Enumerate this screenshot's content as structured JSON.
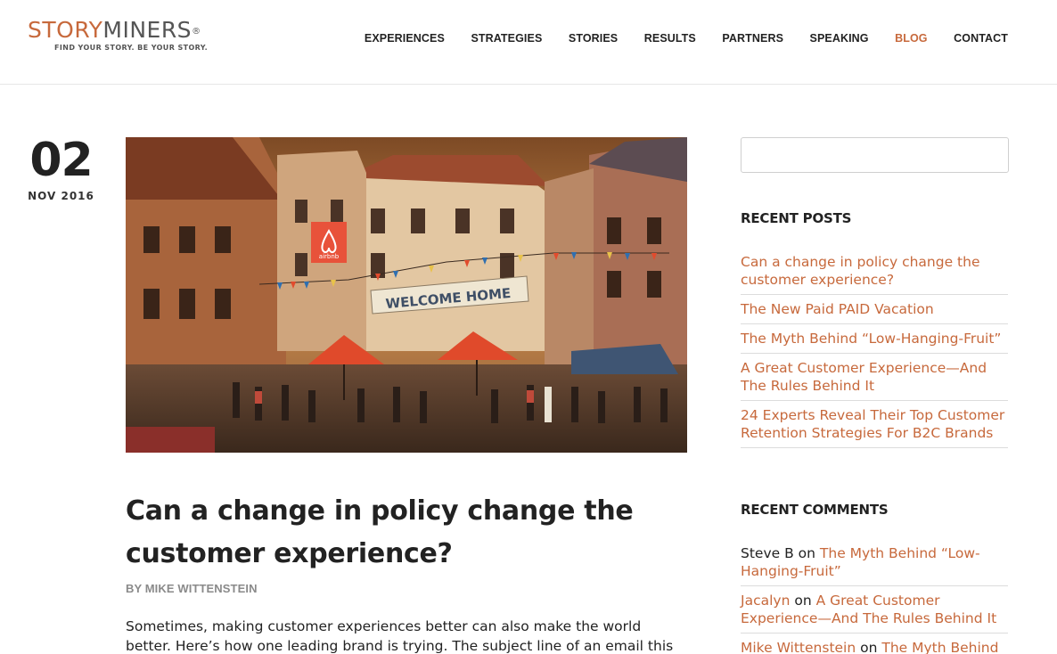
{
  "logo": {
    "word_a": "STORY",
    "word_b": "MINERS",
    "registered": "®",
    "tagline": "FIND YOUR STORY. BE YOUR STORY."
  },
  "nav": {
    "items": [
      {
        "label": "EXPERIENCES"
      },
      {
        "label": "STRATEGIES"
      },
      {
        "label": "STORIES"
      },
      {
        "label": "RESULTS"
      },
      {
        "label": "PARTNERS"
      },
      {
        "label": "SPEAKING"
      },
      {
        "label": "BLOG",
        "active": true
      },
      {
        "label": "CONTACT"
      }
    ]
  },
  "post": {
    "day": "02",
    "month_year": "NOV 2016",
    "image": {
      "sign_text": "WELCOME HOME",
      "brand_text": "airbnb"
    },
    "title": "Can a change in policy change the customer experience?",
    "byline_prefix": "BY ",
    "author": "MIKE WITTENSTEIN",
    "excerpt": "Sometimes, making customer experiences better can also make the world better. Here’s how one leading brand is trying. The subject line of an email this morning said"
  },
  "sidebar": {
    "search_placeholder": "",
    "recent_posts_title": "RECENT POSTS",
    "recent_posts": [
      "Can a change in policy change the customer experience?",
      "The New Paid PAID Vacation",
      "The Myth Behind “Low-Hanging-Fruit”",
      "A Great Customer Experience—And The Rules Behind It",
      "24 Experts Reveal Their Top Customer Retention Strategies For B2C Brands"
    ],
    "recent_comments_title": "RECENT COMMENTS",
    "recent_comments": [
      {
        "author": "Steve B",
        "connector": " on ",
        "post": "The Myth Behind “Low-Hanging-Fruit”"
      },
      {
        "author": "Jacalyn",
        "connector": " on ",
        "post": "A Great Customer Experience—And The Rules Behind It"
      },
      {
        "author": "Mike Wittenstein",
        "connector": " on ",
        "post": "The Myth Behind"
      }
    ]
  },
  "colors": {
    "accent": "#c7693c",
    "text": "#222222",
    "muted": "#8a8a8a",
    "rule": "#dcdcdc"
  }
}
